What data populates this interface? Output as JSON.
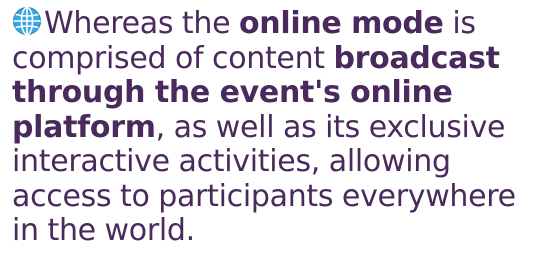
{
  "paragraph": {
    "globe_icon": "globe-icon",
    "seg1": "Whereas the ",
    "bold1": "online mode",
    "seg2": " is comprised of content ",
    "bold2": "broadcast through the event's online platform",
    "seg3": ", as well as its exclusive interactive activities, allowing access to participants everywhere in the world."
  },
  "colors": {
    "text": "#4a2a5c",
    "globe_ocean": "#3aa8e0",
    "globe_land": "#ffffff",
    "background": "#ffffff"
  }
}
